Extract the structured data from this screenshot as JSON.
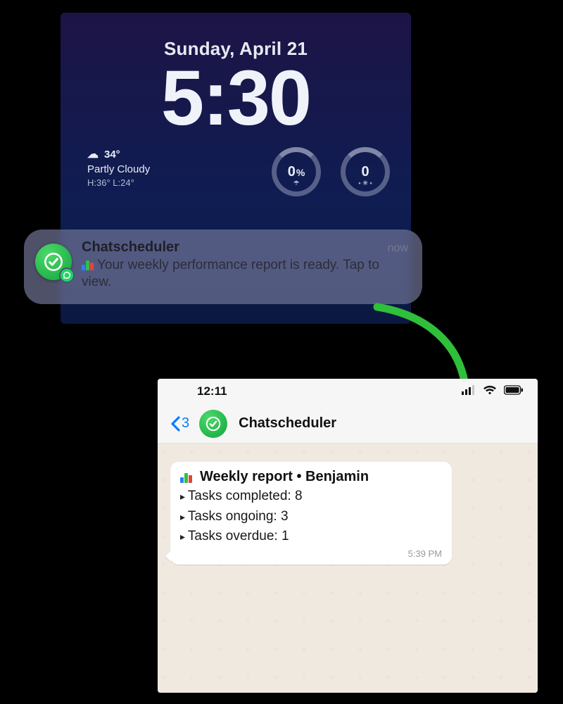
{
  "lockscreen": {
    "date": "Sunday, April 21",
    "time": "5:30",
    "weather": {
      "temp": "34°",
      "cond": "Partly Cloudy",
      "high_low": "H:36° L:24°"
    },
    "gauges": {
      "precip": "0",
      "precip_suffix": "%",
      "uv": "0"
    }
  },
  "notification": {
    "app": "Chatscheduler",
    "time": "now",
    "message": "Your weekly performance report is ready. Tap to view."
  },
  "chat": {
    "status_time": "12:11",
    "unread_count": "3",
    "title": "Chatscheduler",
    "message": {
      "title": "Weekly report • Benjamin",
      "lines": {
        "l0": "Tasks completed: 8",
        "l1": "Tasks ongoing: 3",
        "l2": "Tasks overdue: 1"
      },
      "timestamp": "5:39 PM"
    }
  },
  "colors": {
    "accent_green": "#1fbf4d",
    "ios_blue": "#0a7cff"
  }
}
